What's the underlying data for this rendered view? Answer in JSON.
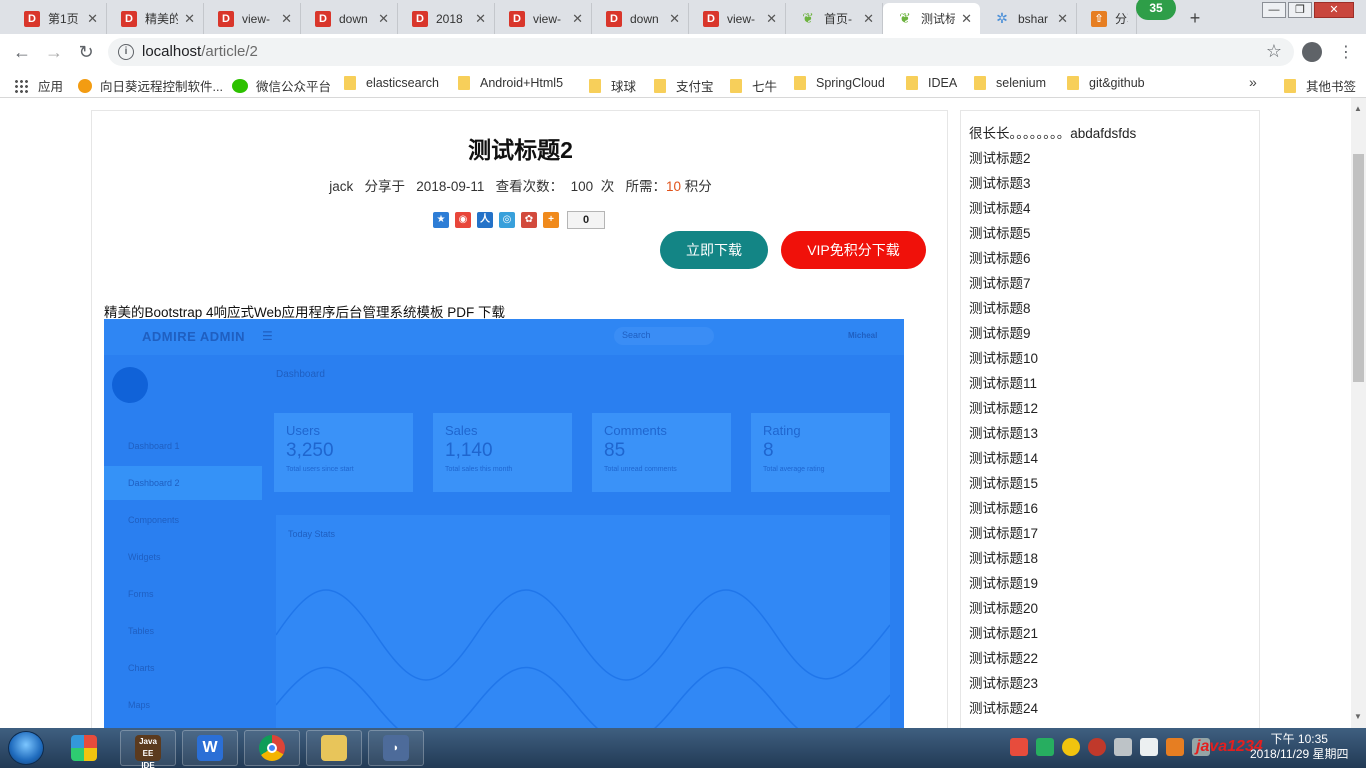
{
  "tabs": [
    {
      "icon": "D",
      "title": "第1页"
    },
    {
      "icon": "D",
      "title": "精美的"
    },
    {
      "icon": "D",
      "title": "view-"
    },
    {
      "icon": "D",
      "title": "down"
    },
    {
      "icon": "D",
      "title": "2018"
    },
    {
      "icon": "D",
      "title": "view-"
    },
    {
      "icon": "D",
      "title": "down"
    },
    {
      "icon": "D",
      "title": "view-"
    },
    {
      "icon": "leaf",
      "title": "首页-"
    },
    {
      "icon": "leaf",
      "title": "测试标"
    },
    {
      "icon": "gear",
      "title": "bshar"
    },
    {
      "icon": "share",
      "title": "分享到"
    }
  ],
  "tab_close": "✕",
  "new_tab": "+",
  "badge": "35",
  "address": {
    "host": "localhost",
    "path": "/article/2"
  },
  "bookmarks": [
    "应用",
    "向日葵远程控制软件...",
    "微信公众平台",
    "elasticsearch",
    "Android+Html5",
    "球球",
    "支付宝",
    "七牛",
    "SpringCloud",
    "IDEA",
    "selenium",
    "git&github"
  ],
  "bookmarks_more": "»",
  "other_bookmarks": "其他书签",
  "article": {
    "title": "测试标题2",
    "author": "jack",
    "shared_at": "分享于",
    "date": "2018-09-11",
    "views_label": "查看次数：",
    "views": "100",
    "views_unit": "次",
    "cost_label": "所需：",
    "cost": "10",
    "cost_unit": "积分",
    "share_count": "0",
    "download_label": "立即下载",
    "vip_download_label": "VIP免积分下载",
    "description": "精美的Bootstrap 4响应式Web应用程序后台管理系统模板  PDF 下载"
  },
  "preview": {
    "brand": "ADMIRE ADMIN",
    "search": "Search",
    "user": "Micheal",
    "breadcrumb": "Dashboard",
    "nav": [
      "Dashboard 1",
      "Dashboard 2",
      "Components",
      "Widgets",
      "Forms",
      "Tables",
      "Charts",
      "Maps"
    ],
    "cards": [
      {
        "k": "Users",
        "v": "3,250",
        "s": "Total users since start"
      },
      {
        "k": "Sales",
        "v": "1,140",
        "s": "Total sales this month"
      },
      {
        "k": "Comments",
        "v": "85",
        "s": "Total unread comments"
      },
      {
        "k": "Rating",
        "v": "8",
        "s": "Total average rating"
      }
    ],
    "panel_title": "Today Stats"
  },
  "sidebar": [
    "很长长。。。。。。。。abdafdsfds",
    "测试标题2",
    "测试标题3",
    "测试标题4",
    "测试标题5",
    "测试标题6",
    "测试标题7",
    "测试标题8",
    "测试标题9",
    "测试标题10",
    "测试标题11",
    "测试标题12",
    "测试标题13",
    "测试标题14",
    "测试标题15",
    "测试标题16",
    "测试标题17",
    "测试标题18",
    "测试标题19",
    "测试标题20",
    "测试标题21",
    "测试标题22",
    "测试标题23",
    "测试标题24"
  ],
  "taskbar": {
    "apps": [
      "start",
      "paint",
      "java-ee-ide",
      "wps-writer",
      "chrome",
      "file-explorer",
      "mysql-tool"
    ],
    "watermark": "java1234",
    "time": "下午 10:35",
    "date": "2018/11/29 星期四"
  }
}
